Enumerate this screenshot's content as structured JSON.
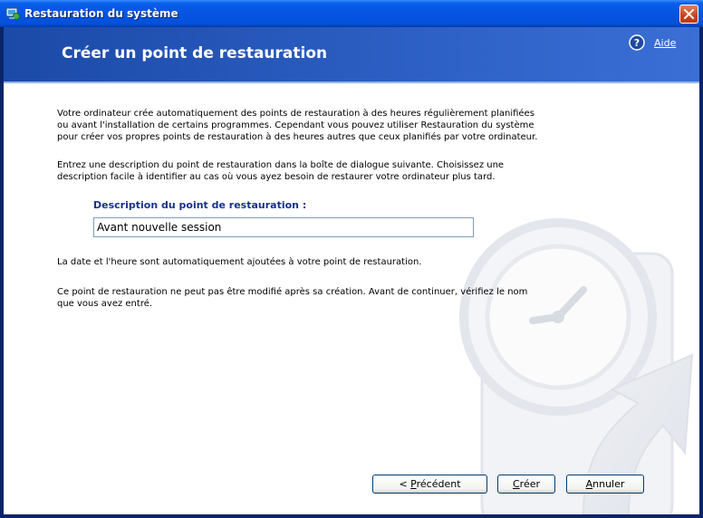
{
  "window": {
    "title": "Restauration du système",
    "close_icon": "close-icon",
    "app_icon": "system-restore-icon"
  },
  "header": {
    "title": "Créer un point de restauration",
    "help_label": "Aide",
    "help_icon": "help-icon"
  },
  "body": {
    "intro": "Votre ordinateur crée automatiquement des points de restauration à des heures régulièrement planifiées ou avant l'installation de certains programmes. Cependant vous pouvez utiliser Restauration du système pour créer vos propres points de restauration à des heures autres que ceux planifiés par votre ordinateur.",
    "instruction": "Entrez une description du point de restauration dans la boîte de dialogue suivante. Choisissez une description facile à identifier au cas où vous ayez besoin de restaurer votre ordinateur plus tard.",
    "field_label": "Description du point de restauration :",
    "field_value": "Avant nouvelle session",
    "date_note": "La date et l'heure sont automatiquement ajoutées à votre point de restauration.",
    "warning_note": "Ce point de restauration ne peut pas être modifié après sa création. Avant de continuer, vérifiez le nom que vous avez entré."
  },
  "buttons": {
    "previous_prefix": "< ",
    "previous_underlined": "P",
    "previous_rest": "récédent",
    "create_underlined": "C",
    "create_rest": "réer",
    "cancel_underlined": "A",
    "cancel_rest": "nnuler"
  },
  "colors": {
    "titlebar": "#0554e3",
    "header_bg": "#2a5cc0",
    "field_label": "#16328c"
  }
}
